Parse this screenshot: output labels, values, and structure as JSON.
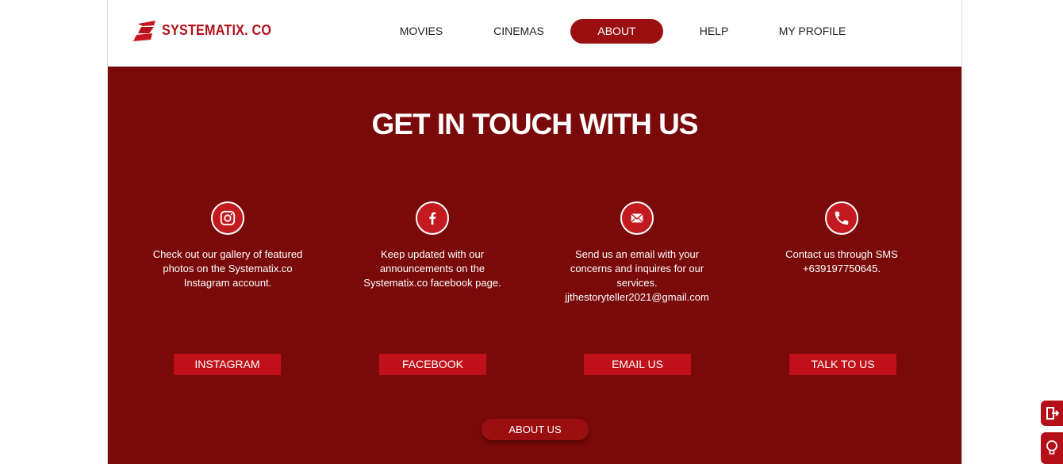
{
  "brand": {
    "name": "SYSTEMATIX. CO"
  },
  "nav": {
    "items": [
      {
        "label": "MOVIES"
      },
      {
        "label": "CINEMAS"
      },
      {
        "label": "ABOUT"
      },
      {
        "label": "HELP"
      },
      {
        "label": "MY PROFILE"
      }
    ],
    "active": "ABOUT"
  },
  "section": {
    "title": "GET IN TOUCH WITH US",
    "cards": [
      {
        "icon": "instagram-icon",
        "text": "Check out our gallery of featured photos on the Systematix.co Instagram account.",
        "button": "INSTAGRAM"
      },
      {
        "icon": "facebook-icon",
        "text": "Keep updated with our announcements on the Systematix.co facebook page.",
        "button": "FACEBOOK"
      },
      {
        "icon": "email-icon",
        "text": "Send us an email with your concerns and inquires for our services.",
        "email": "jjthestoryteller2021@gmail.com",
        "button": "EMAIL US"
      },
      {
        "icon": "phone-icon",
        "text": "Contact us through SMS +639197750645.",
        "button": "TALK TO US"
      }
    ],
    "about_button": "ABOUT US"
  },
  "colors": {
    "accent": "#9c0f10",
    "background": "#7a0a0a",
    "button": "#c0101a",
    "icon": "#c21a1f"
  }
}
